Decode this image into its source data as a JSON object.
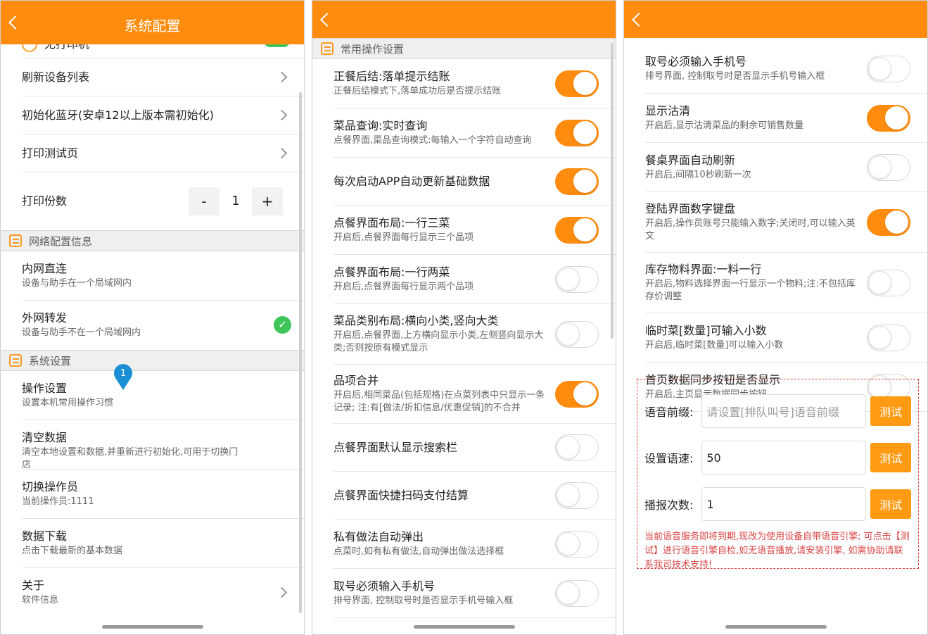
{
  "panel1": {
    "header_title": "系统配置",
    "partial_top_label": "无打印机",
    "partial_top_badge": "OK",
    "rows_printer": [
      {
        "label": "刷新设备列表"
      },
      {
        "label": "初始化蓝牙(安卓12以上版本需初始化)"
      },
      {
        "label": "打印测试页"
      }
    ],
    "print_copies": {
      "label": "打印份数",
      "minus": "-",
      "value": "1",
      "plus": "+"
    },
    "section_network": "网络配置信息",
    "network_rows": [
      {
        "title": "内网直连",
        "subtitle": "设备与助手在一个局域网内"
      },
      {
        "title": "外网转发",
        "subtitle": "设备与助手不在一个局域网内"
      }
    ],
    "check_glyph": "✓",
    "section_system": "系统设置",
    "pin_label": "1",
    "system_rows": [
      {
        "title": "操作设置",
        "subtitle": "设置本机常用操作习惯"
      },
      {
        "title": "清空数据",
        "subtitle": "清空本地设置和数据,并重新进行初始化,可用于切换门店"
      },
      {
        "title": "切换操作员",
        "subtitle": "当前操作员:1111"
      },
      {
        "title": "数据下载",
        "subtitle": "点击下载最新的基本数据"
      },
      {
        "title": "关于",
        "subtitle": "软件信息"
      }
    ]
  },
  "panel2": {
    "section_title": "常用操作设置",
    "rows": [
      {
        "title": "正餐后结:落单提示结账",
        "subtitle": "正餐后结模式下,落单成功后是否提示结账",
        "on": true
      },
      {
        "title": "菜品查询:实时查询",
        "subtitle": "点餐界面,菜品查询模式:每输入一个字符自动查询",
        "on": true
      },
      {
        "title": "每次启动APP自动更新基础数据",
        "subtitle": "",
        "on": true
      },
      {
        "title": "点餐界面布局:一行三菜",
        "subtitle": "开启后,点餐界面每行显示三个品项",
        "on": true
      },
      {
        "title": "点餐界面布局:一行两菜",
        "subtitle": "开启后,点餐界面每行显示两个品项",
        "on": false
      },
      {
        "title": "菜品类别布局:横向小类,竖向大类",
        "subtitle": "开启后,点餐界面,上方横向显示小类,左侧竖向显示大类;否则按原有模式显示",
        "on": false
      },
      {
        "title": "品项合并",
        "subtitle": "开启后,相同菜品(包括规格)在点菜列表中只显示一条记录; 注:有[做法/折扣信息/优惠促销]的不合并",
        "on": true
      },
      {
        "title": "点餐界面默认显示搜索栏",
        "subtitle": "",
        "on": false
      },
      {
        "title": "点餐界面快捷扫码支付结算",
        "subtitle": "",
        "on": false
      },
      {
        "title": "私有做法自动弹出",
        "subtitle": "点菜时,如有私有做法,自动弹出做法选择框",
        "on": false
      },
      {
        "title": "取号必须输入手机号",
        "subtitle": "排号界面, 控制取号时是否显示手机号输入框",
        "on": false
      }
    ]
  },
  "panel3": {
    "rows": [
      {
        "title": "取号必须输入手机号",
        "subtitle": "排号界面, 控制取号时是否显示手机号输入框",
        "on": false
      },
      {
        "title": "显示沽清",
        "subtitle": "开启后,显示沽清菜品的剩余可销售数量",
        "on": true
      },
      {
        "title": "餐桌界面自动刷新",
        "subtitle": "开启后,间隔10秒刷新一次",
        "on": false
      },
      {
        "title": "登陆界面数字键盘",
        "subtitle": "开启后,操作员账号只能输入数字;关闭时,可以输入英文",
        "on": true
      },
      {
        "title": "库存物料界面:一料一行",
        "subtitle": "开启后,物料选择界面一行显示一个物料;注:不包括库存价调整",
        "on": false
      },
      {
        "title": "临时菜[数量]可输入小数",
        "subtitle": "开启后,临时菜[数量]可以输入小数",
        "on": false
      },
      {
        "title": "首页数据同步按钮是否显示",
        "subtitle": "开启后,主页显示数据同步按钮",
        "on": false
      }
    ],
    "voice": {
      "prefix_label": "语音前缀:",
      "prefix_placeholder": "请设置[排队叫号]语音前缀",
      "speed_label": "设置语速:",
      "speed_value": "50",
      "count_label": "播报次数:",
      "count_value": "1",
      "test_label": "测试",
      "note": "当前语音服务即将到期,现改为使用设备自带语音引擎; 可点击【测试】进行语音引擎自检,如无语音播放,请安装引擎, 如需协助请联系我司技术支持!"
    }
  },
  "colors": {
    "accent": "#ff8c0e",
    "toggle_on": "#ff8c0e",
    "check": "#3fc45a",
    "note_red": "#d94444",
    "pin_blue": "#1a8fd6"
  }
}
